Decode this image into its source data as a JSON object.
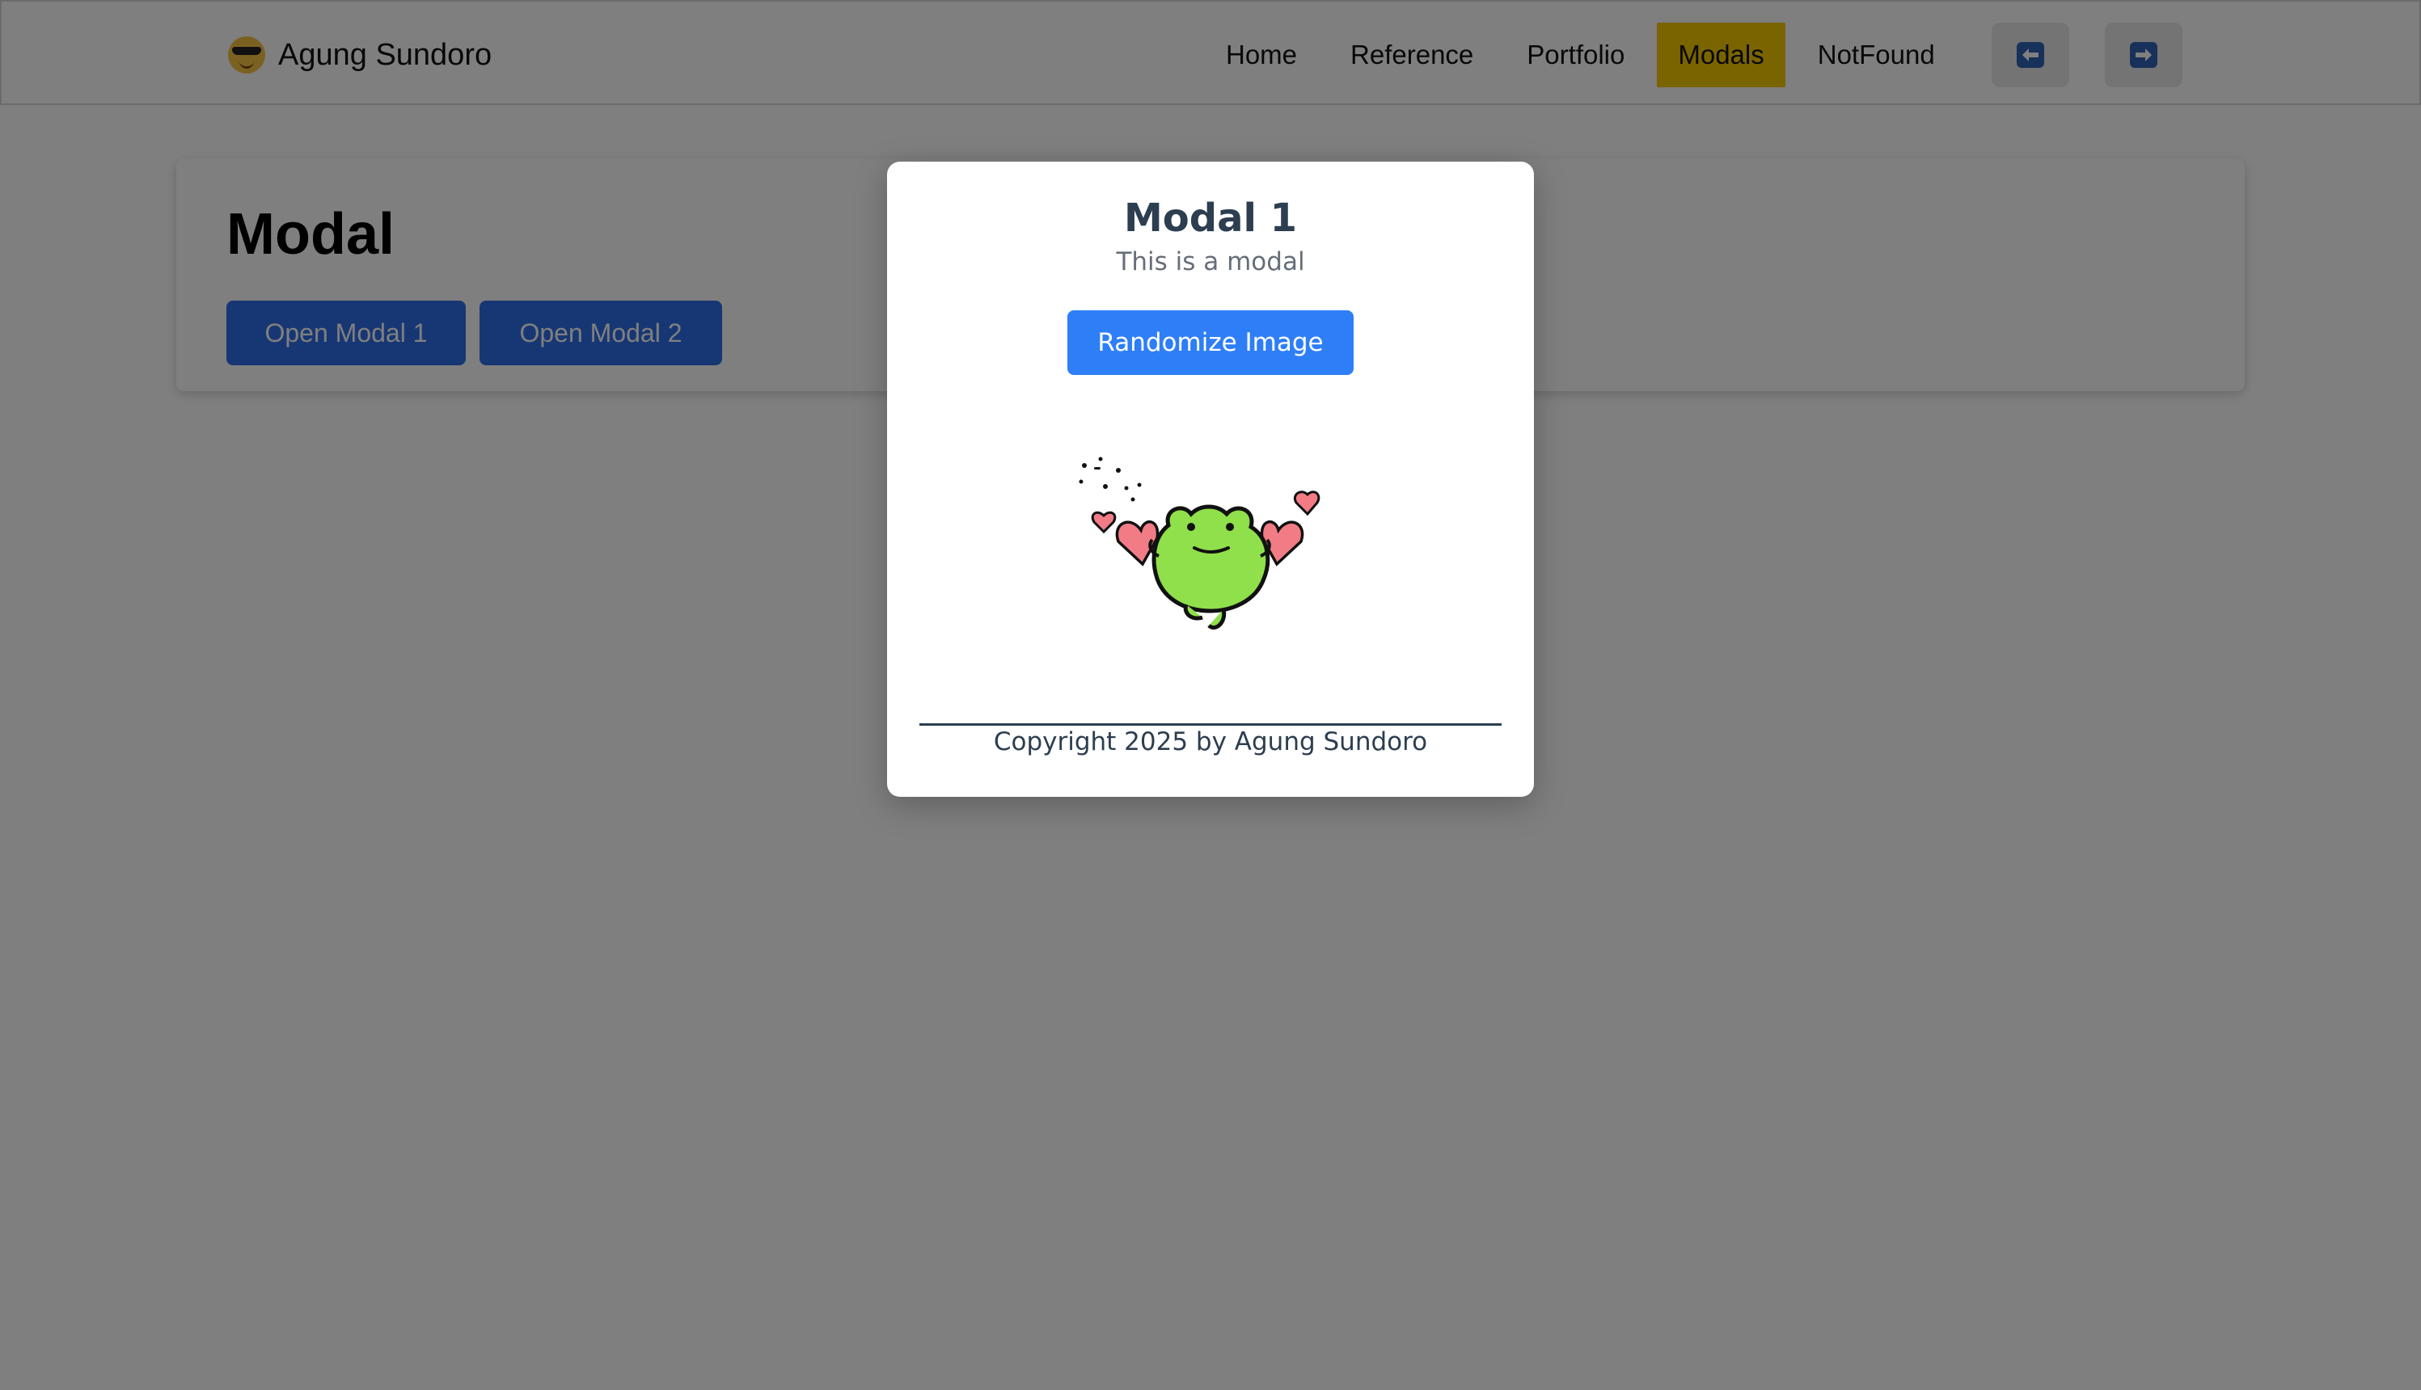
{
  "navbar": {
    "brand_text": "Agung Sundoro",
    "brand_icon": "sunglasses-emoji-icon",
    "links": [
      {
        "label": "Home",
        "active": false
      },
      {
        "label": "Reference",
        "active": false
      },
      {
        "label": "Portfolio",
        "active": false
      },
      {
        "label": "Modals",
        "active": true
      },
      {
        "label": "NotFound",
        "active": false
      }
    ],
    "back_icon": "arrow-left-icon",
    "forward_icon": "arrow-right-icon",
    "active_color": "#f5c800"
  },
  "main": {
    "title": "Modal",
    "buttons": [
      {
        "label": "Open Modal 1"
      },
      {
        "label": "Open Modal 2"
      }
    ],
    "button_color": "#2f6fe8"
  },
  "modal": {
    "title": "Modal 1",
    "subtitle": "This is a modal",
    "button_label": "Randomize Image",
    "button_color": "#2e7ef7",
    "image_icon": "frog-with-hearts-icon",
    "footer": "Copyright 2025 by Agung Sundoro"
  },
  "overlay_color": "rgba(0,0,0,0.5)"
}
